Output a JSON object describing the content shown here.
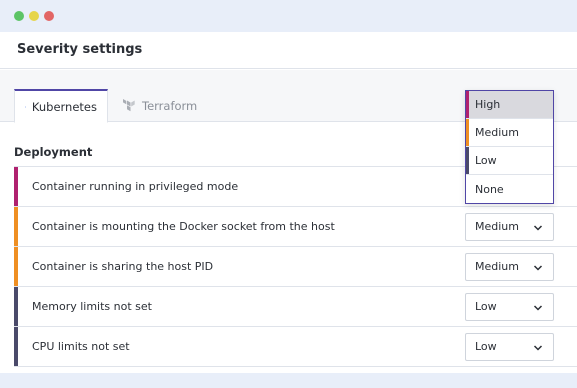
{
  "colors": {
    "dot_green": "#5cc466",
    "dot_yellow": "#e6d54a",
    "dot_red": "#e26565",
    "severity_high": "#b0216f",
    "severity_medium": "#ef8f22",
    "severity_low": "#4a4a6a",
    "accent": "#5046a6"
  },
  "header": {
    "title": "Severity settings"
  },
  "tabs": [
    {
      "label": "Kubernetes",
      "icon": "kubernetes-icon",
      "active": true
    },
    {
      "label": "Terraform",
      "icon": "terraform-icon",
      "active": false
    }
  ],
  "section": {
    "title": "Deployment"
  },
  "rows": [
    {
      "label": "Container running in privileged mode",
      "severity": "High"
    },
    {
      "label": "Container is mounting the Docker socket from the host",
      "severity": "Medium"
    },
    {
      "label": "Container is sharing the host PID",
      "severity": "Medium"
    },
    {
      "label": "Memory limits not set",
      "severity": "Low"
    },
    {
      "label": "CPU limits not set",
      "severity": "Low"
    }
  ],
  "dropdown": {
    "options": [
      "High",
      "Medium",
      "Low",
      "None"
    ],
    "selected": "High"
  }
}
